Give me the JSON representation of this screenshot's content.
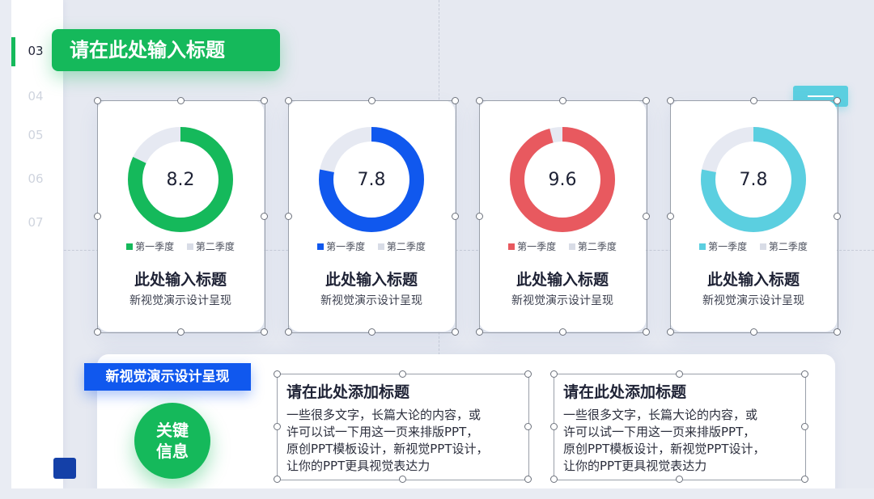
{
  "sidebar": {
    "active_page": "03",
    "pages": [
      "04",
      "05",
      "06",
      "07"
    ]
  },
  "header": {
    "title": "请在此处输入标题"
  },
  "cards": [
    {
      "value": "8.2",
      "fraction": 0.82,
      "color": "#15b95b",
      "legend_a": "第一季度",
      "legend_b": "第二季度",
      "title": "此处输入标题",
      "subtitle": "新视觉演示设计呈现"
    },
    {
      "value": "7.8",
      "fraction": 0.78,
      "color": "#1058ee",
      "legend_a": "第一季度",
      "legend_b": "第二季度",
      "title": "此处输入标题",
      "subtitle": "新视觉演示设计呈现"
    },
    {
      "value": "9.6",
      "fraction": 0.96,
      "color": "#e8595f",
      "legend_a": "第一季度",
      "legend_b": "第二季度",
      "title": "此处输入标题",
      "subtitle": "新视觉演示设计呈现"
    },
    {
      "value": "7.8",
      "fraction": 0.78,
      "color": "#5bcfe0",
      "legend_a": "第一季度",
      "legend_b": "第二季度",
      "title": "此处输入标题",
      "subtitle": "新视觉演示设计呈现"
    }
  ],
  "bottom": {
    "banner": "新视觉演示设计呈现",
    "key_line1": "关键",
    "key_line2": "信息",
    "blocks": [
      {
        "title": "请在此处添加标题",
        "lines": [
          "一些很多文字，长篇大论的内容，或",
          "许可以试一下用这一页来排版PPT，",
          "原创PPT模板设计，新视觉PPT设计，",
          "让你的PPT更具视觉表达力"
        ]
      },
      {
        "title": "请在此处添加标题",
        "lines": [
          "一些很多文字，长篇大论的内容，或",
          "许可以试一下用这一页来排版PPT，",
          "原创PPT模板设计，新视觉PPT设计，",
          "让你的PPT更具视觉表达力"
        ]
      }
    ]
  },
  "colors": {
    "green": "#15b95b",
    "blue": "#1058ee",
    "red": "#e8595f",
    "cyan": "#5bcfe0",
    "track": "#e6e9f2"
  }
}
